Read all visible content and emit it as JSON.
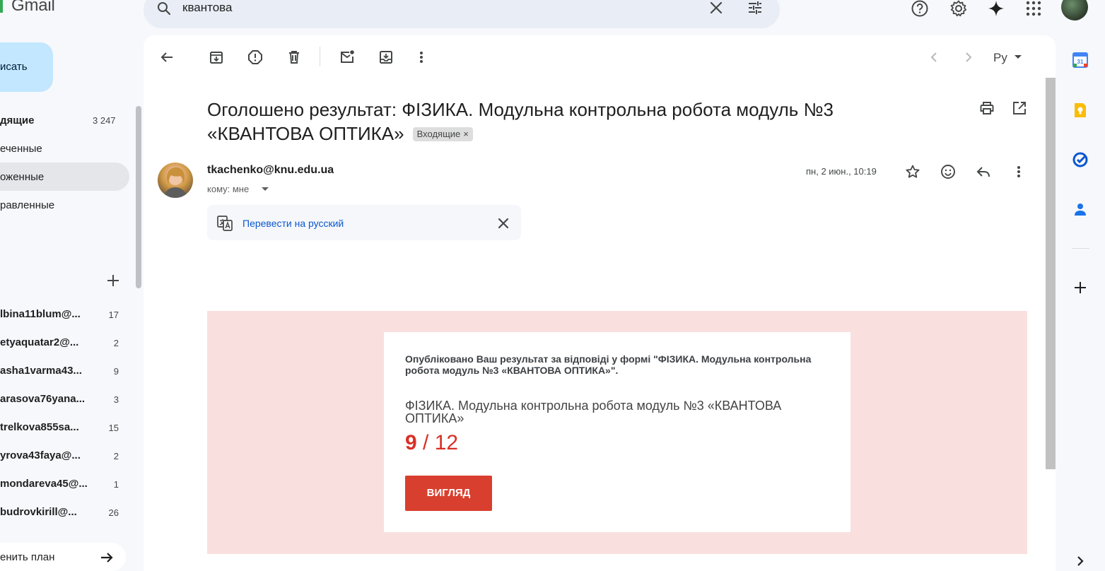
{
  "app": {
    "logo_text": "Gmail"
  },
  "search": {
    "query": "квантова"
  },
  "nav": {
    "compose_label": "исать",
    "items": [
      {
        "label": "дящие",
        "count": "3 247"
      },
      {
        "label": "еченные"
      },
      {
        "label": "оженные"
      },
      {
        "label": "равленные"
      }
    ],
    "contacts": [
      {
        "label": "lbina11blum@...",
        "count": "17"
      },
      {
        "label": "etyaquatar2@...",
        "count": "2"
      },
      {
        "label": "asha1varma43...",
        "count": "9"
      },
      {
        "label": "arasova76yana...",
        "count": "3"
      },
      {
        "label": "trelkova855sa...",
        "count": "15"
      },
      {
        "label": "yrova43faya@...",
        "count": "2"
      },
      {
        "label": "mondareva45@...",
        "count": "1"
      },
      {
        "label": "budrovkirill@...",
        "count": "26"
      }
    ],
    "upgrade_label": "енить план"
  },
  "toolbar": {
    "lang": "Ру"
  },
  "message": {
    "subject_line1": "Оголошено результат: ФІЗИКА. Модульна контрольна робота модуль №3",
    "subject_line2": "«КВАНТОВА ОПТИКА»",
    "label_chip": "Входящие",
    "label_chip_close": "×",
    "sender": "tkachenko@knu.edu.ua",
    "to": "кому: мне",
    "date": "пн, 2 июн., 10:19",
    "translate_link": "Перевести на русский"
  },
  "card": {
    "notice": "Опубліковано Ваш результат за відповіді у формі \"ФІЗИКА. Модульна контрольна робота  модуль №3 «КВАНТОВА ОПТИКА»\".",
    "form_title": "ФІЗИКА. Модульна контрольна робота  модуль №3 «КВАНТОВА ОПТИКА»",
    "score_value": "9",
    "score_rest": " / 12",
    "view_button": "ВИГЛЯД"
  },
  "colors": {
    "accent_red": "#d93f2e",
    "score_red": "#d93025",
    "compose_bg": "#c2e7ff",
    "link_blue": "#0b57d0",
    "body_pink": "#f9e0df"
  }
}
